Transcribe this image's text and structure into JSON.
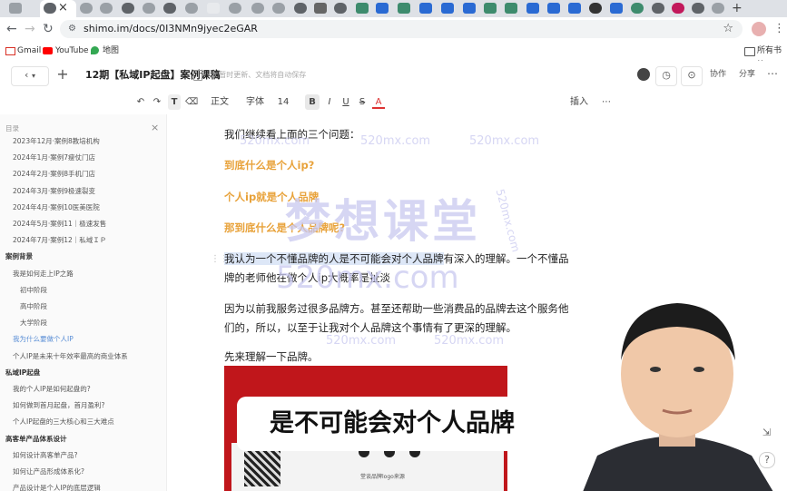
{
  "browser": {
    "url": "shimo.im/docs/0I3NMn9jyec2eGAR",
    "bookmarks": [
      "Gmail",
      "YouTube",
      "地图"
    ],
    "bookmarks_right": "所有书签",
    "new_tab_symbol": "+",
    "close_symbol": "×"
  },
  "toolbar": {
    "doc_title": "12期【私域IP起盘】案例课稿",
    "save_hint": "⊘ 暂时更新、文档将自动保存",
    "collab_label": "协作",
    "share_label": "分享"
  },
  "format": {
    "paragraph_style": "正文",
    "font": "字体",
    "size": "14",
    "insert": "插入"
  },
  "sidebar": {
    "header": "目录",
    "items": [
      {
        "label": "2023年12月·案例8教培机构",
        "level": 1
      },
      {
        "label": "2024年1月·案例7瘦仗门店",
        "level": 1
      },
      {
        "label": "2024年2月·案例8手机门店",
        "level": 1
      },
      {
        "label": "2024年3月·案例9极速裂变",
        "level": 1
      },
      {
        "label": "2024年4月·案例10医美医院",
        "level": 1
      },
      {
        "label": "2024年5月·案例11｜极速发售",
        "level": 1
      },
      {
        "label": "2024年7月·案例12｜私域ＩＰ",
        "level": 1
      },
      {
        "label": "案例背景",
        "level": 0
      },
      {
        "label": "我是如何走上IP之路",
        "level": 1
      },
      {
        "label": "初中阶段",
        "level": 2
      },
      {
        "label": "高中阶段",
        "level": 2
      },
      {
        "label": "大学阶段",
        "level": 2
      },
      {
        "label": "我为什么要做个人IP",
        "level": 1,
        "active": true
      },
      {
        "label": "个人IP是未来十年效率最高的商业体系",
        "level": 1
      },
      {
        "label": "私域IP起盘",
        "level": 0
      },
      {
        "label": "我的个人IP是如何起盘的?",
        "level": 1
      },
      {
        "label": "如何做到首月起盘，首月盈利?",
        "level": 1
      },
      {
        "label": "个人IP起盘的三大核心和三大难点",
        "level": 1
      },
      {
        "label": "高客单产品体系设计",
        "level": 0
      },
      {
        "label": "如何设计高客单产品?",
        "level": 1
      },
      {
        "label": "如何让产品形成体系化?",
        "level": 1
      },
      {
        "label": "产品设计是个人IP的底层逻辑",
        "level": 1
      }
    ]
  },
  "doc": {
    "p1": "我们继续看上面的三个问题：",
    "q1": "到底什么是个人ip?",
    "q2": "个人ip就是个人品牌",
    "q3": "那到底什么是个人品牌呢?",
    "p2_selected": "我认为一个不懂品牌的人是不可能会对个人品牌",
    "p2_rest": "有深入的理解。一个不懂品牌的老师他在做个人ip大概率是扯淡",
    "p3": "因为以前我服务过很多品牌方。甚至还帮助一些消费品的品牌去这个服务他们的，所以，以至于让我对个人品牌这个事情有了更深的理解。",
    "p4": "先来理解一下品牌。",
    "banner_caption": "堂谈品牌logo来源"
  },
  "overlay": {
    "subtitle": "是不可能会对个人品牌",
    "watermark_big": "梦想课堂",
    "watermark_small": "520mx.com"
  },
  "colors": {
    "accent_orange": "#e8a23a",
    "sidebar_active": "#5b8fd6",
    "banner_red": "#c0161b"
  }
}
